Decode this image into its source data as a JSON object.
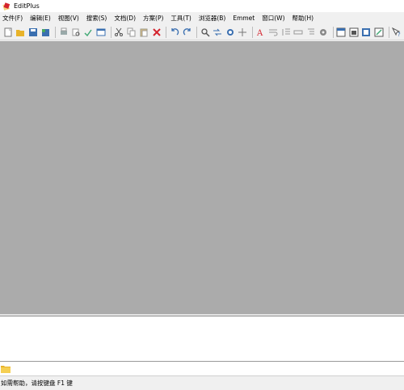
{
  "window": {
    "title": "EditPlus"
  },
  "menu": [
    {
      "label": "文件(F)",
      "name": "menu-file"
    },
    {
      "label": "编辑(E)",
      "name": "menu-edit"
    },
    {
      "label": "视图(V)",
      "name": "menu-view"
    },
    {
      "label": "搜索(S)",
      "name": "menu-search"
    },
    {
      "label": "文档(D)",
      "name": "menu-document"
    },
    {
      "label": "方案(P)",
      "name": "menu-project"
    },
    {
      "label": "工具(T)",
      "name": "menu-tools"
    },
    {
      "label": "浏览器(B)",
      "name": "menu-browser"
    },
    {
      "label": "Emmet",
      "name": "menu-emmet"
    },
    {
      "label": "窗口(W)",
      "name": "menu-window"
    },
    {
      "label": "帮助(H)",
      "name": "menu-help"
    }
  ],
  "toolbar_icons": [
    "new-file-icon",
    "open-file-icon",
    "save-icon",
    "save-all-icon",
    "sep",
    "print-icon",
    "print-preview-icon",
    "spellcheck-icon",
    "browser-icon",
    "sep",
    "cut-icon",
    "copy-icon",
    "paste-icon",
    "delete-icon",
    "sep",
    "undo-icon",
    "redo-icon",
    "sep",
    "find-icon",
    "replace-icon",
    "find-in-files-icon",
    "goto-line-icon",
    "sep",
    "font-icon",
    "word-wrap-icon",
    "line-number-icon",
    "ruler-icon",
    "indent-guide-icon",
    "settings-icon",
    "sep",
    "tile-horizontal-icon",
    "tile-vertical-icon",
    "cascade-icon",
    "full-screen-icon",
    "sep",
    "help-icon"
  ],
  "status": {
    "text": "如需帮助，请按键盘 F1 键"
  },
  "colors": {
    "workspace": "#ababab",
    "accent_red": "#d4242e",
    "accent_yellow": "#e8b32a"
  }
}
